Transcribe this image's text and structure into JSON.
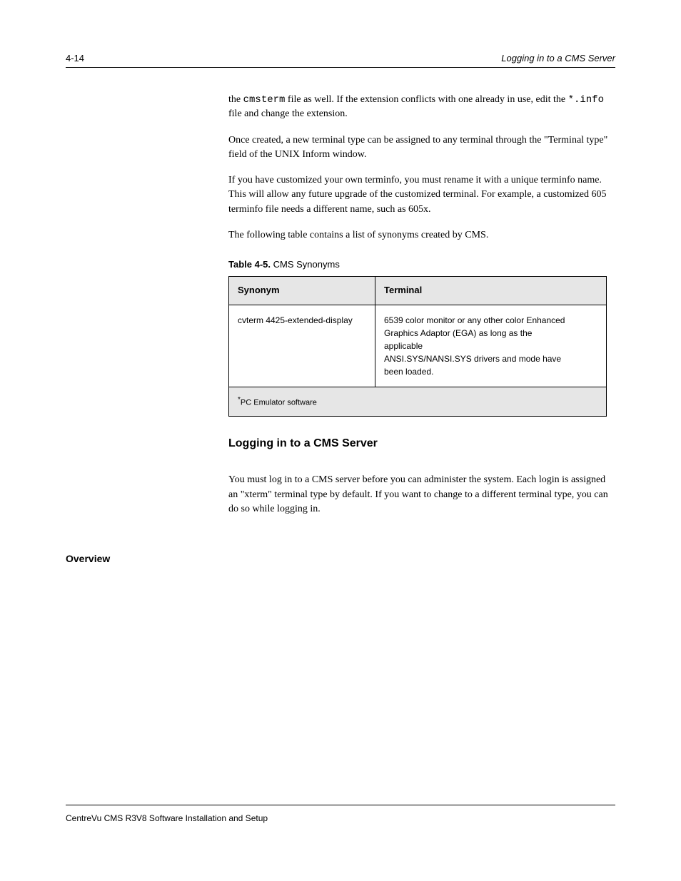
{
  "header": {
    "left": "4-14",
    "right": "Logging in to a CMS Server"
  },
  "paragraphs": {
    "p1_a": "the ",
    "p1_b": " file as well. If the extension conflicts with one already in use, edit the ",
    "p1_c": " file and change the extension.",
    "p2": "Once created, a new terminal type can be assigned to any terminal through the \"Terminal type\" field of the UNIX Inform window.",
    "p3": "If you have customized your own terminfo, you must rename it with a unique terminfo name. This will allow any future upgrade of the customized terminal. For example, a customized 605 terminfo file needs a different name, such as 605x.",
    "p4": "The following table contains a list of synonyms created by CMS.",
    "code_cmsterm": "cmsterm",
    "code_info": "*.info"
  },
  "table": {
    "title_prefix": "Table 4-5.",
    "title_rest": "CMS Synonyms",
    "col1_header": "Synonym",
    "col2_header": "Terminal",
    "row": {
      "col1_lines": [
        "cvterm 4425-extended-display"
      ],
      "col2_lines": [
        "6539 color monitor or any other color Enhanced",
        "Graphics Adaptor (EGA) as long as the",
        "applicable",
        "ANSI.SYS/NANSI.SYS drivers and mode have",
        "been loaded."
      ]
    },
    "footer_sup": "*",
    "footer_text": "PC Emulator software"
  },
  "section": {
    "sidebar_label": "Overview",
    "heading": "Logging in to a CMS Server",
    "body": "You must log in to a CMS server before you can administer the system. Each login is assigned an \"xterm\" terminal type by default. If you want to change to a different terminal type, you can do so while logging in."
  },
  "footer": {
    "left": "CentreVu CMS R3V8 Software Installation and Setup",
    "right": ""
  }
}
